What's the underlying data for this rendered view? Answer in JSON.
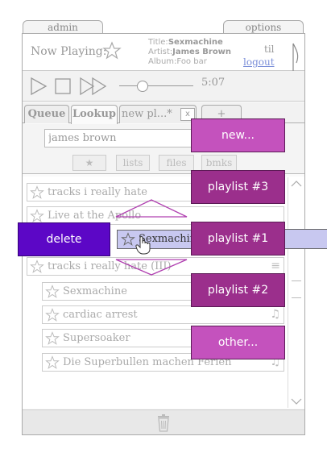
{
  "top_tabs": {
    "admin": "admin",
    "options": "options"
  },
  "now_playing": {
    "label": "Now Playing:",
    "title_label": "Title:",
    "title": "Sexmachine",
    "artist_label": "Artist:",
    "artist": "James Brown",
    "album_label": "Album:",
    "album": "Foo bar",
    "user": "til",
    "logout": "logout"
  },
  "player": {
    "time": "5:07",
    "progress": 0.3
  },
  "tabs": [
    "Queue",
    "Lookup",
    "new pl...*",
    "x",
    "+"
  ],
  "search": {
    "value": "james brown"
  },
  "filters": [
    "★",
    "lists",
    "files",
    "bmks"
  ],
  "list_rows": [
    "tracks i really hate",
    "Live at the Apollo",
    "tracks i really hate (III)",
    "Sexmachine",
    "cardiac arrest",
    "Supersoaker",
    "Die Superbullen machen Ferien"
  ],
  "drag_item": "Sexmachine",
  "menu": {
    "new": "new...",
    "p3": "playlist #3",
    "p1": "playlist #1",
    "p2": "playlist #2",
    "other": "other..."
  },
  "delete_label": "delete",
  "colors": {
    "menu": "#9b2f8c",
    "menu_light": "#c452bd",
    "delete": "#5c07c6",
    "drag": "#c8c8f0",
    "link": "#7b8fd9"
  },
  "icons": [
    "star-icon",
    "play-icon",
    "stop-icon",
    "fast-forward-icon",
    "cherry-note-logo",
    "music-note-icon",
    "trash-icon",
    "hand-cursor-icon"
  ]
}
